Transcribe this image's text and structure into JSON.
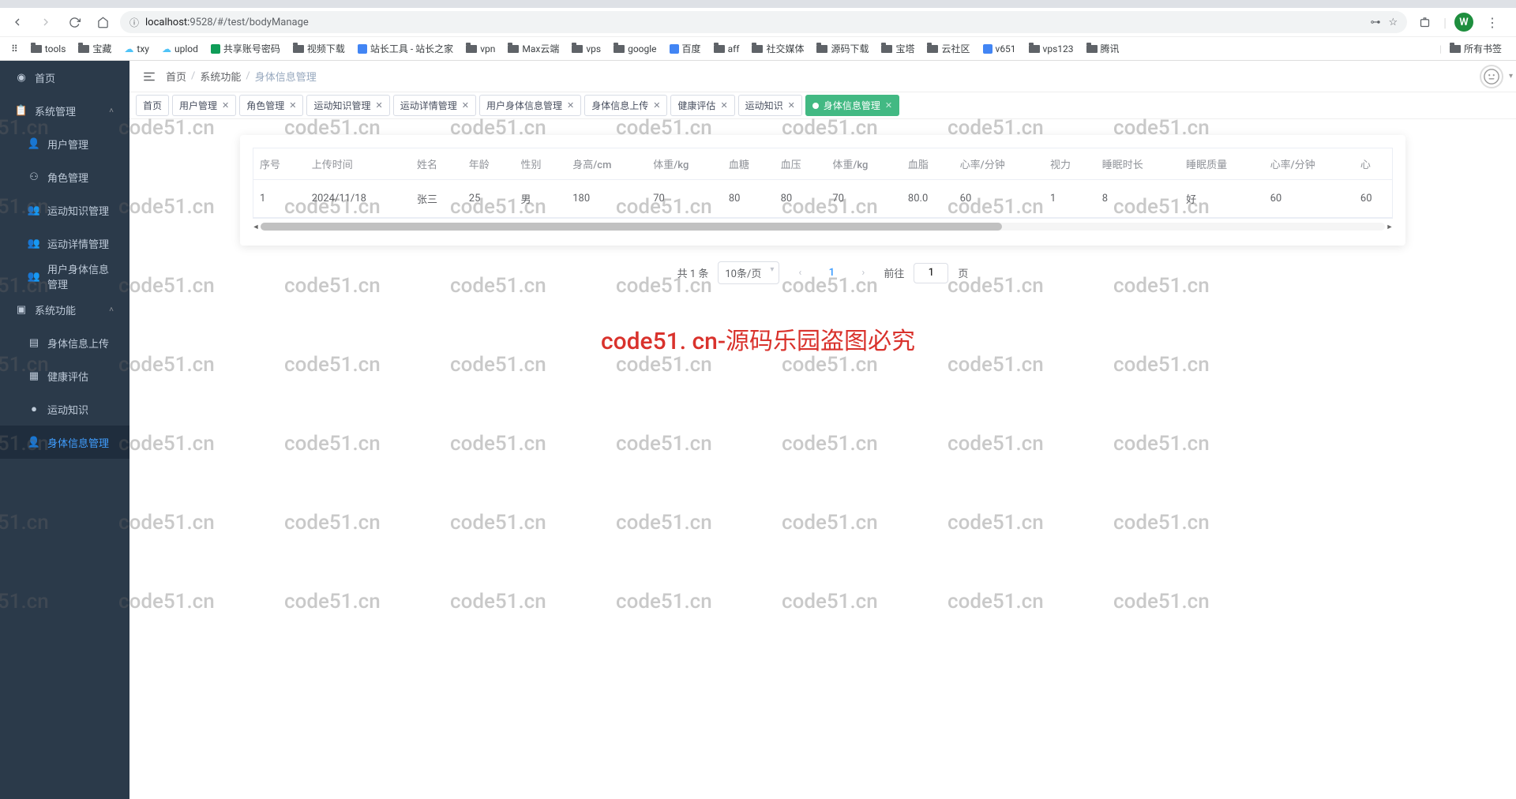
{
  "browser": {
    "url_host": "localhost:",
    "url_port_path": "9528/#/test/bodyManage",
    "avatar_letter": "W"
  },
  "bookmarks": [
    {
      "label": "tools",
      "type": "folder"
    },
    {
      "label": "宝藏",
      "type": "folder"
    },
    {
      "label": "txy",
      "type": "cloud"
    },
    {
      "label": "uplod",
      "type": "cloud"
    },
    {
      "label": "共享账号密码",
      "type": "doc"
    },
    {
      "label": "视频下载",
      "type": "folder"
    },
    {
      "label": "站长工具 - 站长之家",
      "type": "site"
    },
    {
      "label": "vpn",
      "type": "folder"
    },
    {
      "label": "Max云端",
      "type": "folder"
    },
    {
      "label": "vps",
      "type": "folder"
    },
    {
      "label": "google",
      "type": "folder"
    },
    {
      "label": "百度",
      "type": "site"
    },
    {
      "label": "aff",
      "type": "folder"
    },
    {
      "label": "社交媒体",
      "type": "folder"
    },
    {
      "label": "源码下载",
      "type": "folder"
    },
    {
      "label": "宝塔",
      "type": "folder"
    },
    {
      "label": "云社区",
      "type": "folder"
    },
    {
      "label": "v651",
      "type": "site"
    },
    {
      "label": "vps123",
      "type": "folder"
    },
    {
      "label": "腾讯",
      "type": "folder"
    }
  ],
  "bookmarks_right": {
    "label": "所有书签"
  },
  "sidebar": {
    "home": "首页",
    "group1": "系统管理",
    "items1": [
      "用户管理",
      "角色管理",
      "运动知识管理",
      "运动详情管理",
      "用户身体信息管理"
    ],
    "group2": "系统功能",
    "items2": [
      "身体信息上传",
      "健康评估",
      "运动知识",
      "身体信息管理"
    ]
  },
  "breadcrumb": [
    "首页",
    "系统功能",
    "身体信息管理"
  ],
  "tabs": [
    {
      "label": "首页",
      "closable": false
    },
    {
      "label": "用户管理",
      "closable": true
    },
    {
      "label": "角色管理",
      "closable": true
    },
    {
      "label": "运动知识管理",
      "closable": true
    },
    {
      "label": "运动详情管理",
      "closable": true
    },
    {
      "label": "用户身体信息管理",
      "closable": true
    },
    {
      "label": "身体信息上传",
      "closable": true
    },
    {
      "label": "健康评估",
      "closable": true
    },
    {
      "label": "运动知识",
      "closable": true
    },
    {
      "label": "身体信息管理",
      "closable": true,
      "active": true
    }
  ],
  "table": {
    "headers": [
      "序号",
      "上传时间",
      "姓名",
      "年龄",
      "性别",
      "身高/cm",
      "体重/kg",
      "血糖",
      "血压",
      "体重/kg",
      "血脂",
      "心率/分钟",
      "视力",
      "睡眠时长",
      "睡眠质量",
      "心率/分钟",
      "心"
    ],
    "rows": [
      [
        "1",
        "2024/11/18",
        "张三",
        "25",
        "男",
        "180",
        "70",
        "80",
        "80",
        "70",
        "80.0",
        "60",
        "1",
        "8",
        "好",
        "60",
        "60"
      ]
    ]
  },
  "pagination": {
    "total": "共 1 条",
    "page_size": "10条/页",
    "current_page": "1",
    "go_prefix": "前往",
    "go_input": "1",
    "go_suffix": "页"
  },
  "watermark": {
    "small": "code51.cn",
    "big": "code51. cn-源码乐园盗图必究"
  }
}
